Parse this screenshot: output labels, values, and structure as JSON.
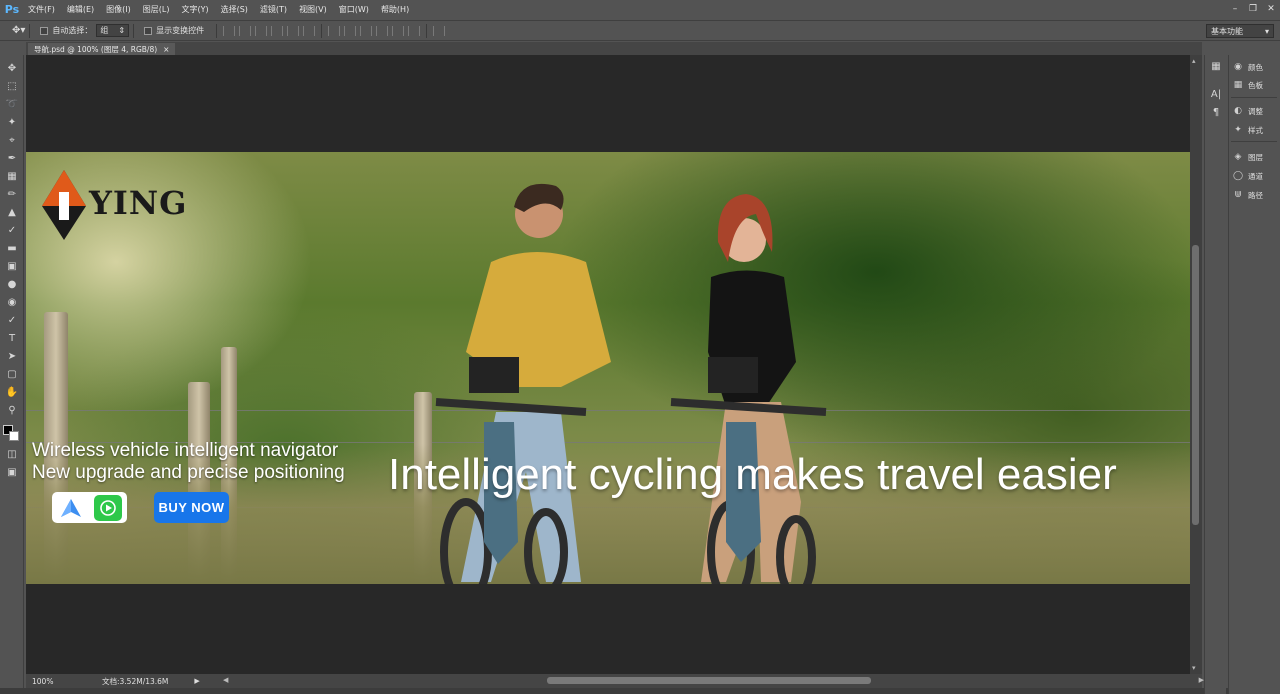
{
  "app": {
    "logo": "Ps"
  },
  "menubar": {
    "items": [
      "文件(F)",
      "编辑(E)",
      "图像(I)",
      "图层(L)",
      "文字(Y)",
      "选择(S)",
      "滤镜(T)",
      "视图(V)",
      "窗口(W)",
      "帮助(H)"
    ]
  },
  "options": {
    "auto_select_label": "自动选择：",
    "auto_select_value": "组",
    "show_transform_label": "显示变换控件",
    "workspace": "基本功能"
  },
  "document_tab": {
    "label": "导航.psd @ 100% (图层 4, RGB/8)",
    "close": "×"
  },
  "status": {
    "zoom": "100%",
    "doc_info": "文档:3.52M/13.6M"
  },
  "panels": {
    "items": [
      "颜色",
      "色板",
      "调整",
      "样式",
      "图层",
      "通道",
      "路径"
    ]
  },
  "banner": {
    "logo_text": "YING",
    "tagline_1": "Wireless vehicle intelligent navigator",
    "tagline_2": "New upgrade and precise positioning",
    "buy_button": "BUY NOW",
    "headline": "Intelligent cycling makes travel easier",
    "accent_color": "#1876ea"
  }
}
